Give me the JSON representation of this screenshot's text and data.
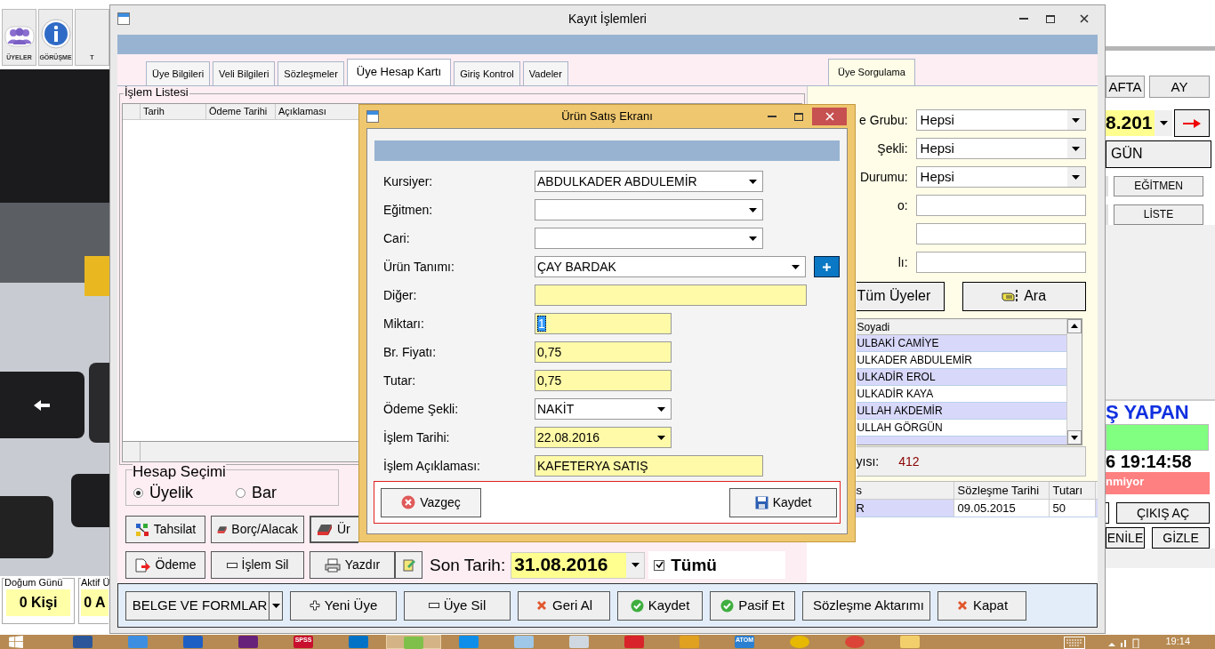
{
  "background_app": {
    "toolbar": [
      {
        "label": "ÜYELER"
      },
      {
        "label": "GÖRÜŞME"
      },
      {
        "label": "T"
      }
    ],
    "stats": [
      {
        "title": "Doğum Günü",
        "value": "0 Kişi"
      },
      {
        "title": "Aktif Ü",
        "value": "0 A"
      }
    ],
    "period_buttons": [
      "AFTA",
      "AY"
    ],
    "date": "8.201",
    "day_button": "GÜN",
    "side_buttons": [
      "EĞİTMEN",
      "LİSTE"
    ],
    "heading": "Ş YAPAN",
    "clock": "6 19:14:58",
    "alert": "nmiyor",
    "bottom_buttons": [
      "ÇIKIŞ AÇ",
      "ENİLE",
      "GİZLE"
    ]
  },
  "main_window": {
    "title": "Kayıt İşlemleri",
    "tabs": [
      {
        "label": "Üye Bilgileri",
        "selected": false
      },
      {
        "label": "Veli Bilgileri",
        "selected": false
      },
      {
        "label": "Sözleşmeler",
        "selected": false
      },
      {
        "label": "Üye Hesap Kartı",
        "selected": true
      },
      {
        "label": "Giriş Kontrol",
        "selected": false
      },
      {
        "label": "Vadeler",
        "selected": false
      }
    ],
    "query_tab": {
      "label": "Üye Sorgulama",
      "selected": true
    },
    "transactions": {
      "title": "İşlem Listesi",
      "columns": [
        "Tarih",
        "Ödeme Tarihi",
        "Açıklaması"
      ]
    },
    "account_selection": {
      "title": "Hesap Seçimi",
      "options": [
        {
          "label": "Üyelik",
          "selected": true
        },
        {
          "label": "Bar",
          "selected": false
        }
      ]
    },
    "action_rows": [
      [
        {
          "label": "Tahsilat"
        },
        {
          "label": "Borç/Alacak"
        },
        {
          "label": "Ür"
        }
      ],
      [
        {
          "label": "Ödeme"
        },
        {
          "label": "İşlem Sil"
        },
        {
          "label": "Yazdır"
        }
      ]
    ],
    "end_date": {
      "label": "Son Tarih:",
      "value": "31.08.2016"
    },
    "all_checkbox": {
      "label": "Tümü",
      "checked": true
    },
    "query": {
      "fields": [
        {
          "kind": "select",
          "label": "e Grubu:",
          "value": "Hepsi"
        },
        {
          "kind": "select",
          "label": "Şekli:",
          "value": "Hepsi"
        },
        {
          "kind": "select",
          "label": "Durumu:",
          "value": "Hepsi"
        },
        {
          "kind": "input",
          "label": "o:"
        },
        {
          "kind": "input"
        },
        {
          "kind": "input",
          "label": "lı:"
        }
      ],
      "buttons": [
        {
          "label": "Tüm Üyeler"
        },
        {
          "label": "Ara"
        }
      ],
      "members": {
        "column": "Soyadi",
        "rows": [
          "ULBAKİ CAMİYE",
          "ULKADER ABDULEMİR",
          "ULKADİR EROL",
          "ULKADİR KAYA",
          "ULLAH AKDEMİR",
          "ULLAH GÖRGÜN"
        ]
      },
      "count": {
        "label": "yısı:",
        "value": "412"
      }
    },
    "contracts": {
      "columns": [
        "s",
        "Sözleşme Tarihi",
        "Tutarı"
      ],
      "rows": [
        [
          "R",
          "09.05.2015",
          "50"
        ]
      ]
    },
    "bottom_buttons": [
      {
        "label": "BELGE VE FORMLAR",
        "dropdown": true
      },
      {
        "label": "Yeni Üye",
        "dropdown": false
      },
      {
        "label": "Üye Sil",
        "dropdown": false
      },
      {
        "label": "Geri Al",
        "dropdown": false
      },
      {
        "label": "Kaydet",
        "dropdown": false
      },
      {
        "label": "Pasif Et",
        "dropdown": false
      },
      {
        "label": "Sözleşme Aktarımı",
        "dropdown": false
      },
      {
        "label": "Kapat",
        "dropdown": false
      }
    ]
  },
  "dialog": {
    "title": "Ürün Satış Ekranı",
    "fields": [
      {
        "label": "Kursiyer:",
        "kind": "select",
        "value": "ABDULKADER ABDULEMİR",
        "highlighted": false,
        "text_selected": false,
        "add_button": false
      },
      {
        "label": "Eğitmen:",
        "kind": "select",
        "highlighted": false,
        "text_selected": false,
        "add_button": false
      },
      {
        "label": "Cari:",
        "kind": "select",
        "highlighted": false,
        "text_selected": false,
        "add_button": false
      },
      {
        "label": "Ürün Tanımı:",
        "kind": "select",
        "value": "ÇAY BARDAK",
        "highlighted": false,
        "text_selected": false,
        "add_button": true
      },
      {
        "label": "Diğer:",
        "kind": "input",
        "highlighted": true,
        "text_selected": false,
        "add_button": false
      },
      {
        "label": "Miktarı:",
        "kind": "input",
        "value": "1",
        "highlighted": true,
        "text_selected": true,
        "add_button": false
      },
      {
        "label": "Br. Fiyatı:",
        "kind": "input",
        "value": "0,75",
        "highlighted": true,
        "text_selected": false,
        "add_button": false
      },
      {
        "label": "Tutar:",
        "kind": "input",
        "value": "0,75",
        "highlighted": true,
        "text_selected": false,
        "add_button": false
      },
      {
        "label": "Ödeme Şekli:",
        "kind": "select",
        "value": "NAKİT",
        "highlighted": false,
        "text_selected": false,
        "add_button": false
      },
      {
        "label": "İşlem Tarihi:",
        "kind": "select",
        "value": "22.08.2016",
        "highlighted": true,
        "text_selected": false,
        "add_button": false
      },
      {
        "label": "İşlem Açıklaması:",
        "kind": "input",
        "value": "KAFETERYA SATIŞ",
        "highlighted": true,
        "text_selected": false,
        "add_button": false
      }
    ],
    "buttons": [
      {
        "label": "Vazgeç"
      },
      {
        "label": "Kaydet"
      }
    ]
  },
  "taskbar": {
    "apps": [
      {
        "kind": "word",
        "selected": false
      },
      {
        "kind": "chart",
        "selected": false
      },
      {
        "kind": "blue",
        "selected": false
      },
      {
        "kind": "vs",
        "selected": false
      },
      {
        "kind": "spss",
        "label": "SPSS",
        "selected": false
      },
      {
        "kind": "mail",
        "selected": false
      },
      {
        "kind": "notepadpp",
        "selected": true
      },
      {
        "kind": "remote",
        "selected": false
      },
      {
        "kind": "notepad",
        "selected": false
      },
      {
        "kind": "window",
        "selected": false
      },
      {
        "kind": "fred",
        "selected": false
      },
      {
        "kind": "seven",
        "selected": false
      },
      {
        "kind": "atom",
        "label": "ATOM",
        "selected": false
      },
      {
        "kind": "yellow",
        "selected": false
      },
      {
        "kind": "chrome",
        "selected": false
      },
      {
        "kind": "folder",
        "selected": false
      }
    ],
    "clock": "19:14"
  }
}
